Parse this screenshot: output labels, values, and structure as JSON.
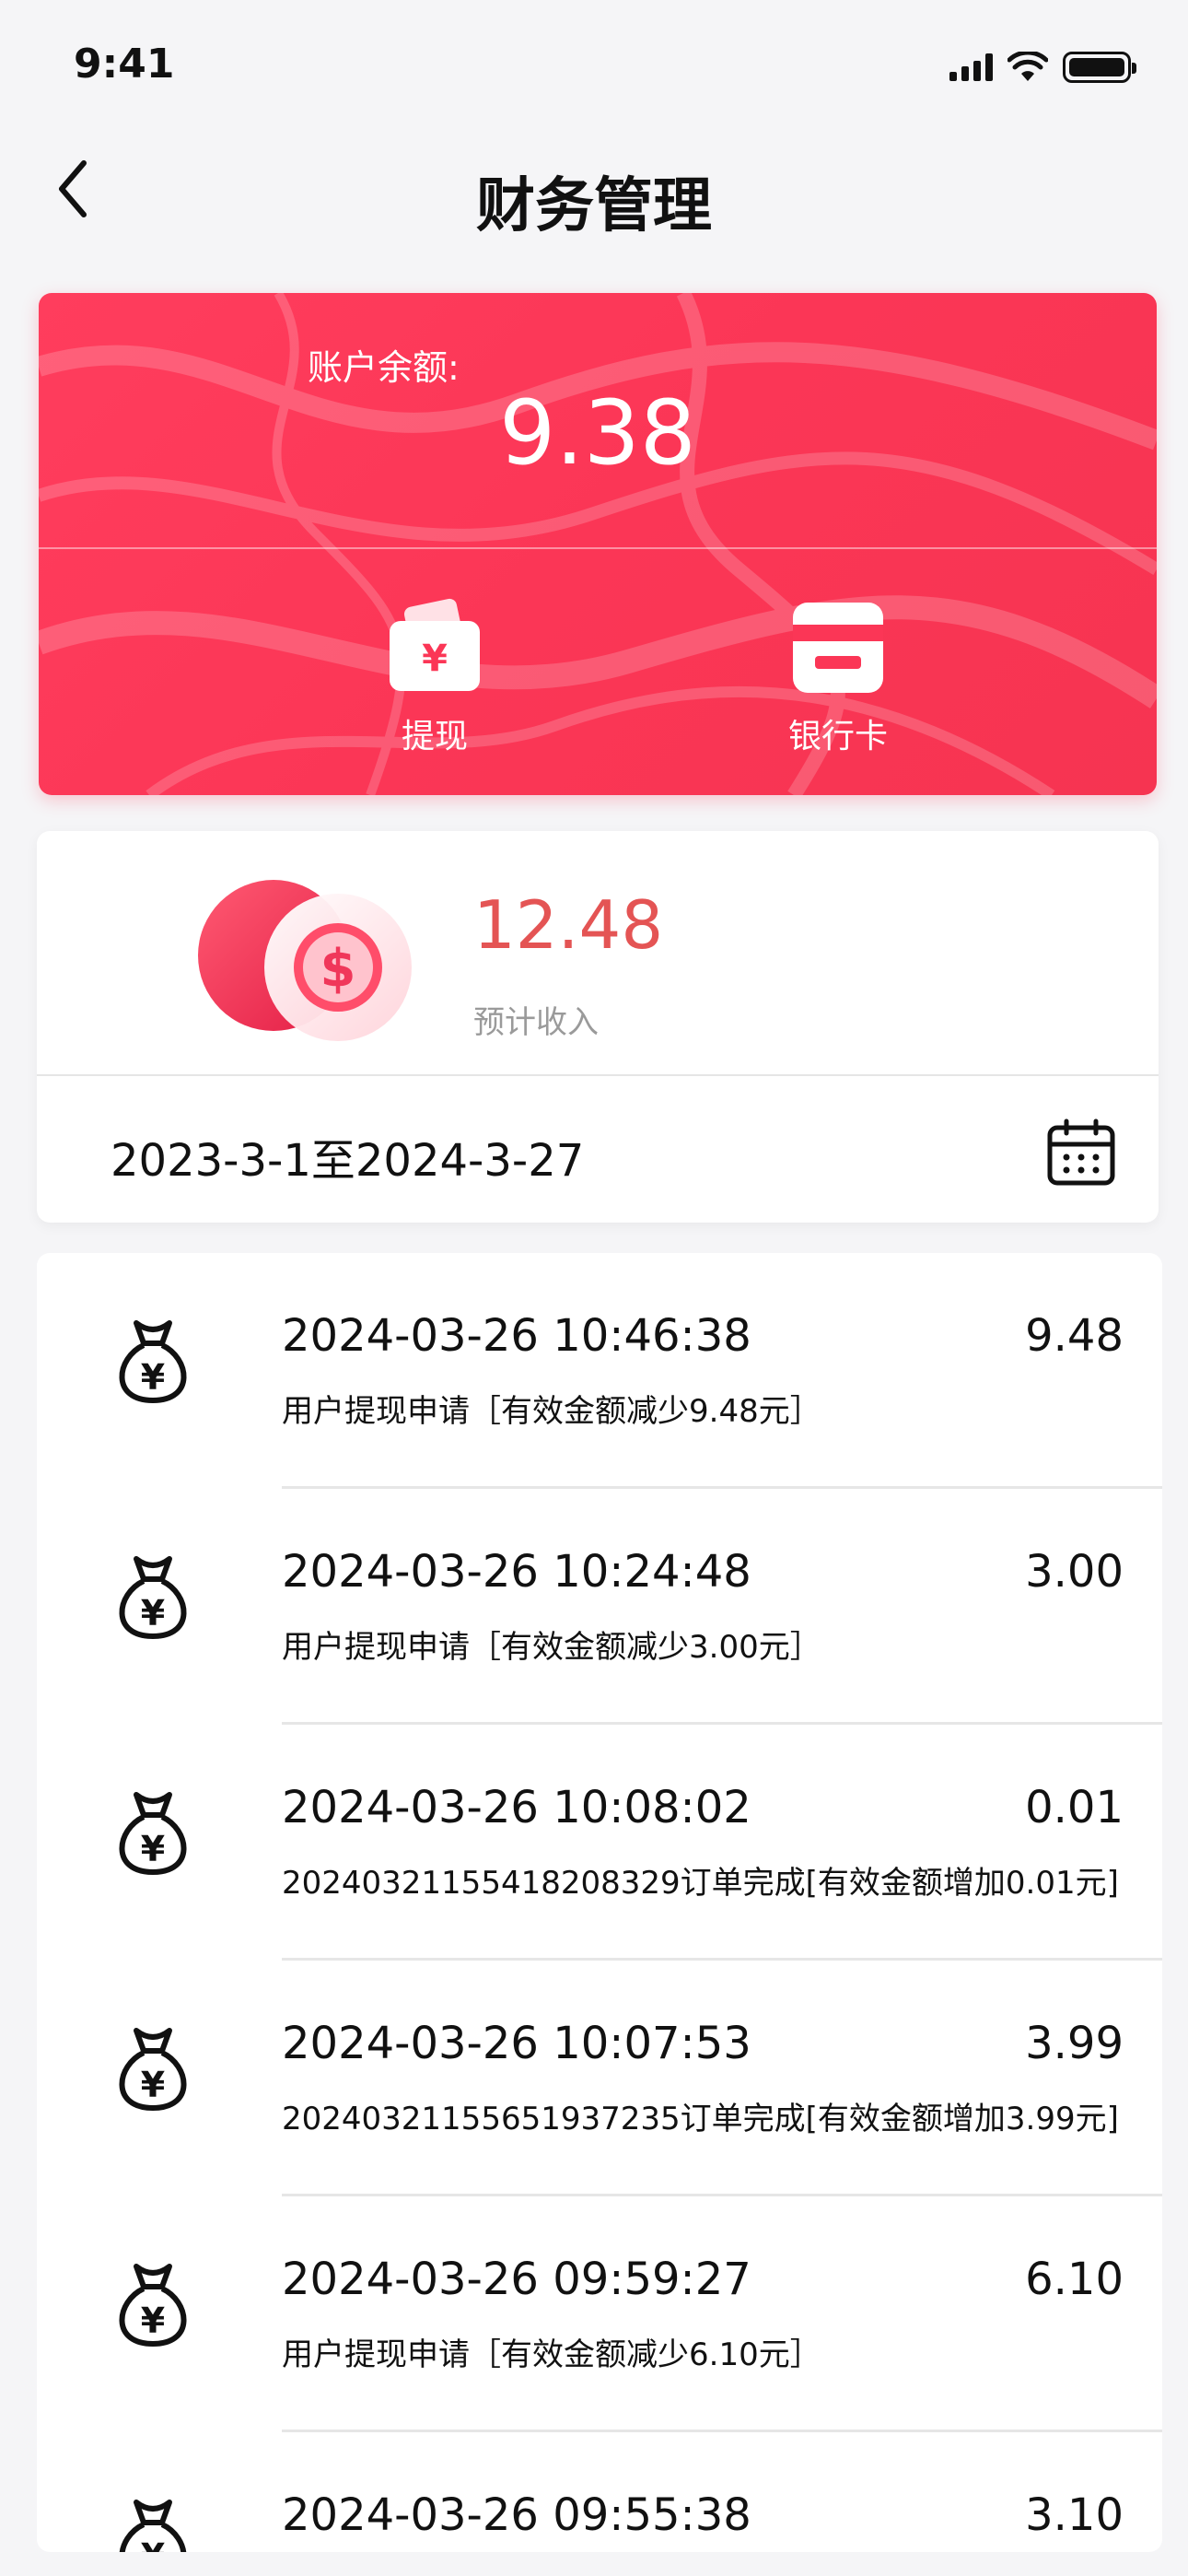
{
  "status_bar": {
    "time": "9:41"
  },
  "nav": {
    "title": "财务管理"
  },
  "balance": {
    "label": "账户余额:",
    "value": "9.38",
    "actions": [
      {
        "label": "提现",
        "icon": "wallet-yen-icon"
      },
      {
        "label": "银行卡",
        "icon": "bank-card-icon"
      }
    ]
  },
  "income": {
    "value": "12.48",
    "label": "预计收入",
    "date_range": "2023-3-1至2024-3-27"
  },
  "records": [
    {
      "time": "2024-03-26 10:46:38",
      "amount": "9.48",
      "desc": "用户提现申请［有效金额减少9.48元］"
    },
    {
      "time": "2024-03-26 10:24:48",
      "amount": "3.00",
      "desc": "用户提现申请［有效金额减少3.00元］"
    },
    {
      "time": "2024-03-26 10:08:02",
      "amount": "0.01",
      "desc": "20240321155418208329订单完成[有效金额增加0.01元]"
    },
    {
      "time": "2024-03-26 10:07:53",
      "amount": "3.99",
      "desc": "20240321155651937235订单完成[有效金额增加3.99元]"
    },
    {
      "time": "2024-03-26 09:59:27",
      "amount": "6.10",
      "desc": "用户提现申请［有效金额减少6.10元］"
    },
    {
      "time": "2024-03-26 09:55:38",
      "amount": "3.10",
      "desc": ""
    }
  ],
  "colors": {
    "accent": "#fb3656",
    "income": "#e45454"
  }
}
